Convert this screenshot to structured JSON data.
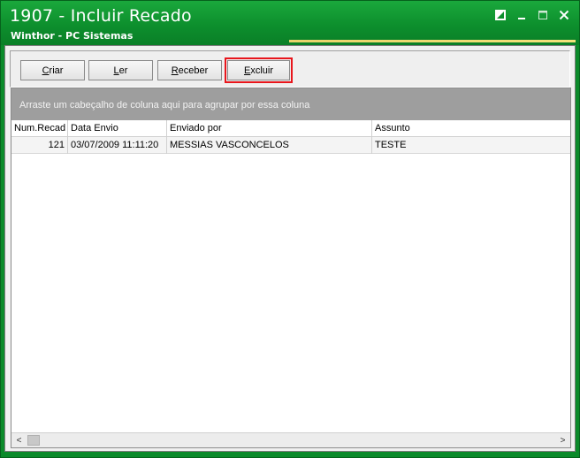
{
  "window": {
    "title": "1907 - Incluir Recado",
    "subtitle": "Winthor - PC Sistemas",
    "controls": [
      "restore-icon",
      "minimize-icon",
      "maximize-icon",
      "close-icon"
    ]
  },
  "toolbar": {
    "buttons": [
      {
        "first": "C",
        "rest": "riar"
      },
      {
        "first": "L",
        "rest": "er"
      },
      {
        "first": "R",
        "rest": "eceber"
      },
      {
        "first": "E",
        "rest": "xcluir"
      }
    ],
    "highlight_color": "#e8161c"
  },
  "grid": {
    "group_hint": "Arraste um cabeçalho de coluna aqui para agrupar por essa coluna",
    "columns": [
      "Num.Recad",
      "Data Envio",
      "Enviado por",
      "Assunto"
    ],
    "rows": [
      [
        "121",
        "03/07/2009 11:11:20",
        "MESSIAS VASCONCELOS",
        "TESTE"
      ]
    ]
  },
  "scrollbar": {
    "left_arrow": "<",
    "right_arrow": ">"
  },
  "colors": {
    "titlebar": "#0d8f2d",
    "group_panel": "#9e9e9e"
  }
}
